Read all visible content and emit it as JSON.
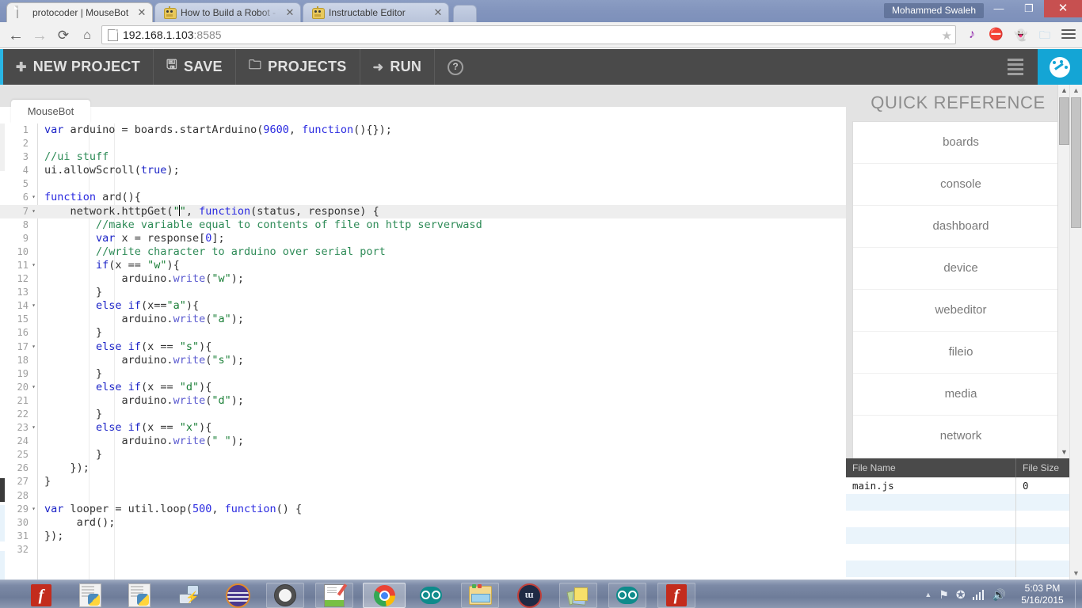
{
  "window": {
    "user_label": "Mohammed Swaleh",
    "minimize": "—",
    "maximize": "❐",
    "close": "✕"
  },
  "browser": {
    "tabs": [
      {
        "title": "protocoder | MouseBot",
        "icon": "document-icon",
        "active": true,
        "close": "✕"
      },
      {
        "title": "How to Build a Robot - Th",
        "icon": "robot-icon",
        "active": false,
        "close": "✕"
      },
      {
        "title": "Instructable Editor",
        "icon": "robot-icon",
        "active": false,
        "close": "✕"
      }
    ],
    "nav": {
      "back": "←",
      "forward": "→",
      "reload": "⟳",
      "home": "⌂"
    },
    "address": {
      "host": "192.168.1.103",
      "port": ":8585",
      "page_icon": "page-icon",
      "star": "★"
    },
    "extensions": [
      {
        "name": "music-note-icon",
        "glyph": "♪",
        "color": "#8e24aa"
      },
      {
        "name": "adblock-stop-icon",
        "glyph": "⛔",
        "color": "#c62828"
      },
      {
        "name": "ghostery-icon",
        "glyph": "👻",
        "color": "#9e9e9e"
      },
      {
        "name": "folder-icon",
        "glyph": "🗀",
        "color": "#9ec9e8"
      }
    ],
    "menu": "menu-icon"
  },
  "app_toolbar": {
    "items": [
      {
        "label": "NEW PROJECT",
        "icon": "plus-icon",
        "glyph": "✚"
      },
      {
        "label": "SAVE",
        "icon": "floppy-disk-icon",
        "glyph": "🖫"
      },
      {
        "label": "PROJECTS",
        "icon": "folder-icon",
        "glyph": "🗀"
      },
      {
        "label": "RUN",
        "icon": "arrow-right-icon",
        "glyph": "➜"
      },
      {
        "label": "",
        "icon": "help-icon",
        "glyph": "?"
      }
    ],
    "right_icons": [
      {
        "name": "list-view-icon"
      },
      {
        "name": "dashboard-gauge-icon"
      }
    ]
  },
  "editor": {
    "tab_label": "MouseBot",
    "lines": [
      {
        "n": "1",
        "fold": "",
        "indent": 0,
        "html": "<span class='tok-kw'>var</span> arduino = boards.startArduino(<span class='tok-num'>9600</span>, <span class='tok-fn'>function</span>(){});"
      },
      {
        "n": "2",
        "fold": "",
        "indent": 0,
        "html": ""
      },
      {
        "n": "3",
        "fold": "",
        "indent": 0,
        "html": "<span class='tok-com'>//ui stuff</span>"
      },
      {
        "n": "4",
        "fold": "",
        "indent": 0,
        "html": "ui.allowScroll(<span class='tok-kw'>true</span>);"
      },
      {
        "n": "5",
        "fold": "",
        "indent": 0,
        "html": ""
      },
      {
        "n": "6",
        "fold": "▾",
        "indent": 0,
        "html": "<span class='tok-fn'>function</span> ard(){"
      },
      {
        "n": "7",
        "fold": "▾",
        "indent": 1,
        "html": "    network.httpGet(<span class='tok-str'>\"</span><span class='caret'></span><span class='tok-str'>\"</span>, <span class='tok-fn'>function</span>(status, response) {",
        "highlight": true
      },
      {
        "n": "8",
        "fold": "",
        "indent": 2,
        "html": "        <span class='tok-com'>//make variable equal to contents of file on http serverwasd</span>"
      },
      {
        "n": "9",
        "fold": "",
        "indent": 2,
        "html": "        <span class='tok-kw'>var</span> x = response[<span class='tok-num'>0</span>];"
      },
      {
        "n": "10",
        "fold": "",
        "indent": 2,
        "html": "        <span class='tok-com'>//write character to arduino over serial port</span>"
      },
      {
        "n": "11",
        "fold": "▾",
        "indent": 2,
        "html": "        <span class='tok-kw'>if</span>(x == <span class='tok-str'>\"w\"</span>){"
      },
      {
        "n": "12",
        "fold": "",
        "indent": 3,
        "html": "            arduino.<span class='tok-meth'>write</span>(<span class='tok-str'>\"w\"</span>);"
      },
      {
        "n": "13",
        "fold": "",
        "indent": 2,
        "html": "        }"
      },
      {
        "n": "14",
        "fold": "▾",
        "indent": 2,
        "html": "        <span class='tok-kw'>else if</span>(x==<span class='tok-str'>\"a\"</span>){"
      },
      {
        "n": "15",
        "fold": "",
        "indent": 3,
        "html": "            arduino.<span class='tok-meth'>write</span>(<span class='tok-str'>\"a\"</span>);"
      },
      {
        "n": "16",
        "fold": "",
        "indent": 2,
        "html": "        }"
      },
      {
        "n": "17",
        "fold": "▾",
        "indent": 2,
        "html": "        <span class='tok-kw'>else if</span>(x == <span class='tok-str'>\"s\"</span>){"
      },
      {
        "n": "18",
        "fold": "",
        "indent": 3,
        "html": "            arduino.<span class='tok-meth'>write</span>(<span class='tok-str'>\"s\"</span>);"
      },
      {
        "n": "19",
        "fold": "",
        "indent": 2,
        "html": "        }"
      },
      {
        "n": "20",
        "fold": "▾",
        "indent": 2,
        "html": "        <span class='tok-kw'>else if</span>(x == <span class='tok-str'>\"d\"</span>){"
      },
      {
        "n": "21",
        "fold": "",
        "indent": 3,
        "html": "            arduino.<span class='tok-meth'>write</span>(<span class='tok-str'>\"d\"</span>);"
      },
      {
        "n": "22",
        "fold": "",
        "indent": 2,
        "html": "        }"
      },
      {
        "n": "23",
        "fold": "▾",
        "indent": 2,
        "html": "        <span class='tok-kw'>else if</span>(x == <span class='tok-str'>\"x\"</span>){"
      },
      {
        "n": "24",
        "fold": "",
        "indent": 3,
        "html": "            arduino.<span class='tok-meth'>write</span>(<span class='tok-str'>\" \"</span>);"
      },
      {
        "n": "25",
        "fold": "",
        "indent": 2,
        "html": "        }"
      },
      {
        "n": "26",
        "fold": "",
        "indent": 1,
        "html": "    });"
      },
      {
        "n": "27",
        "fold": "",
        "indent": 0,
        "html": "}"
      },
      {
        "n": "28",
        "fold": "",
        "indent": 0,
        "html": ""
      },
      {
        "n": "29",
        "fold": "▾",
        "indent": 0,
        "html": "<span class='tok-kw'>var</span> looper = util.loop(<span class='tok-num'>500</span>, <span class='tok-fn'>function</span>() {"
      },
      {
        "n": "30",
        "fold": "",
        "indent": 1,
        "html": "     ard();"
      },
      {
        "n": "31",
        "fold": "",
        "indent": 0,
        "html": "});"
      },
      {
        "n": "32",
        "fold": "",
        "indent": 0,
        "html": ""
      }
    ]
  },
  "quick_reference": {
    "title": "QUICK REFERENCE",
    "items": [
      "boards",
      "console",
      "dashboard",
      "device",
      "webeditor",
      "fileio",
      "media",
      "network"
    ],
    "scroll": {
      "up": "▲",
      "down": "▼"
    }
  },
  "file_table": {
    "columns": [
      "File Name",
      "File Size"
    ],
    "rows": [
      {
        "name": "main.js",
        "size": "0"
      },
      {
        "name": "",
        "size": ""
      },
      {
        "name": "",
        "size": ""
      },
      {
        "name": "",
        "size": ""
      },
      {
        "name": "",
        "size": ""
      },
      {
        "name": "",
        "size": ""
      }
    ]
  },
  "page_scroll": {
    "up": "▲",
    "down": "▼"
  },
  "taskbar": {
    "buttons": [
      {
        "name": "processing-app",
        "icon": "processing-icon"
      },
      {
        "name": "python-file-1",
        "icon": "python-file-icon"
      },
      {
        "name": "python-file-2",
        "icon": "python-file-icon"
      },
      {
        "name": "network-tool",
        "icon": "network-icon"
      },
      {
        "name": "ubuntu-app",
        "icon": "striped-circle-icon"
      },
      {
        "name": "tooth-app",
        "icon": "white-circle-icon"
      },
      {
        "name": "notepad-plus-plus",
        "icon": "notepad-icon"
      },
      {
        "name": "google-chrome",
        "icon": "chrome-icon",
        "active": true
      },
      {
        "name": "arduino-ide",
        "icon": "arduino-icon"
      },
      {
        "name": "file-explorer",
        "icon": "folder-icon"
      },
      {
        "name": "mw-app",
        "icon": "mw-icon"
      },
      {
        "name": "sticky-notes",
        "icon": "notes-icon"
      },
      {
        "name": "arduino-ide-2",
        "icon": "arduino-icon"
      },
      {
        "name": "processing-app-2",
        "icon": "processing-icon"
      }
    ],
    "tray": {
      "expand": "▲",
      "icons": [
        "flag-warning-icon",
        "action-center-icon",
        "network-signal-icon",
        "volume-icon"
      ],
      "time": "5:03 PM",
      "date": "5/16/2015"
    }
  },
  "colors": {
    "accent_blue": "#14a5d5",
    "toolbar_dark": "#4a4a4a",
    "tab_strip": "#8294bd",
    "close_red": "#c75050"
  }
}
